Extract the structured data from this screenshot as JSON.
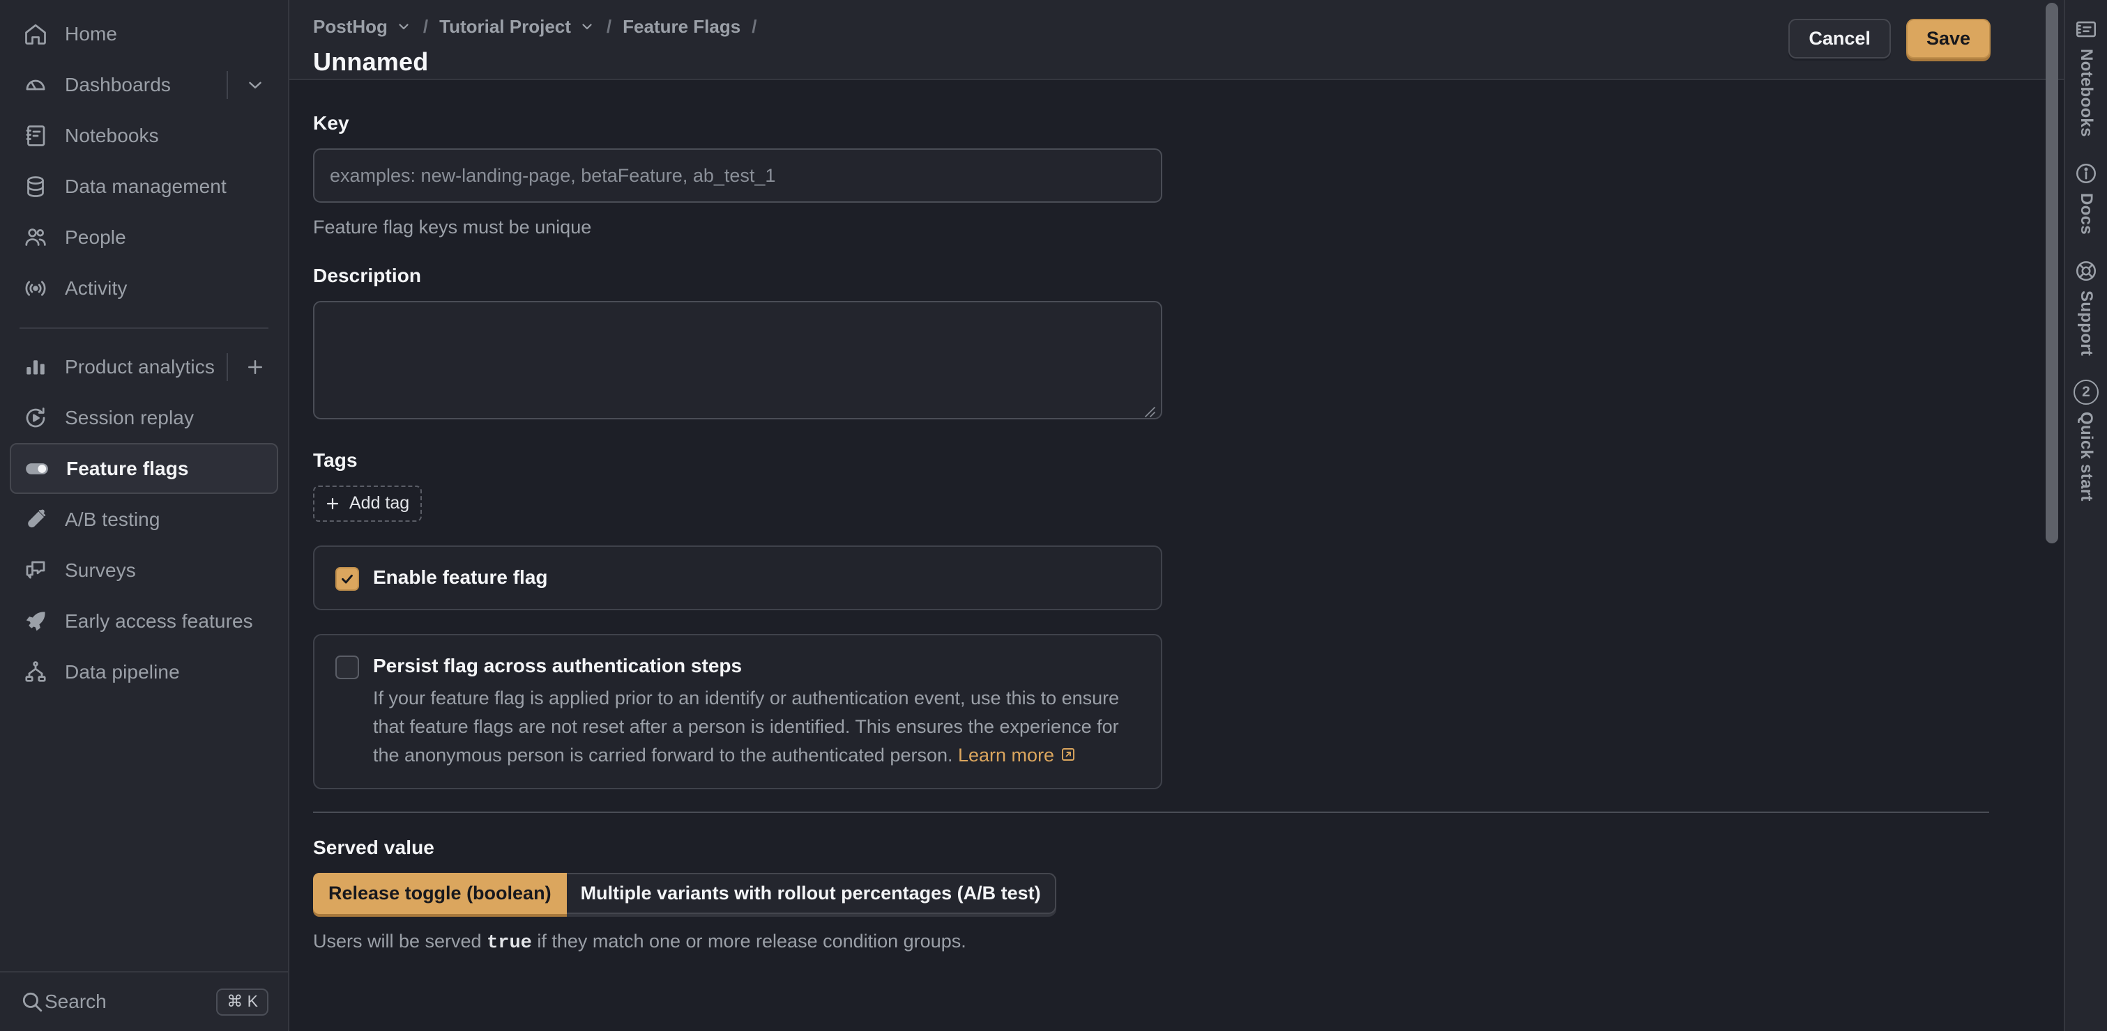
{
  "sidebar": {
    "items": [
      {
        "label": "Home",
        "icon": "home-icon",
        "active": false
      },
      {
        "label": "Dashboards",
        "icon": "dashboards-icon",
        "active": false,
        "trailing": "chevron-down-icon"
      },
      {
        "label": "Notebooks",
        "icon": "notebook-icon",
        "active": false
      },
      {
        "label": "Data management",
        "icon": "database-icon",
        "active": false
      },
      {
        "label": "People",
        "icon": "people-icon",
        "active": false
      },
      {
        "label": "Activity",
        "icon": "activity-icon",
        "active": false
      }
    ],
    "items2": [
      {
        "label": "Product analytics",
        "icon": "bar-chart-icon",
        "active": false,
        "trailing": "plus-icon"
      },
      {
        "label": "Session replay",
        "icon": "play-replay-icon",
        "active": false
      },
      {
        "label": "Feature flags",
        "icon": "toggle-icon",
        "active": true
      },
      {
        "label": "A/B testing",
        "icon": "flask-icon",
        "active": false
      },
      {
        "label": "Surveys",
        "icon": "chat-icon",
        "active": false
      },
      {
        "label": "Early access features",
        "icon": "rocket-icon",
        "active": false
      },
      {
        "label": "Data pipeline",
        "icon": "pipeline-icon",
        "active": false
      }
    ],
    "search": {
      "label": "Search",
      "shortcut": "⌘ K",
      "icon": "search-icon"
    }
  },
  "header": {
    "breadcrumbs": [
      {
        "label": "PostHog",
        "has_chevron": true
      },
      {
        "label": "Tutorial Project",
        "has_chevron": true
      },
      {
        "label": "Feature Flags",
        "has_chevron": false
      }
    ],
    "separator": "/",
    "title": "Unnamed",
    "cancel_label": "Cancel",
    "save_label": "Save"
  },
  "form": {
    "key": {
      "label": "Key",
      "value": "",
      "placeholder": "examples: new-landing-page, betaFeature, ab_test_1",
      "hint": "Feature flag keys must be unique"
    },
    "description": {
      "label": "Description",
      "value": "",
      "placeholder": ""
    },
    "tags": {
      "label": "Tags",
      "add_label": "Add tag"
    },
    "enable_flag": {
      "label": "Enable feature flag",
      "checked": true
    },
    "persist_flag": {
      "label": "Persist flag across authentication steps",
      "checked": false,
      "description": "If your feature flag is applied prior to an identify or authentication event, use this to ensure that feature flags are not reset after a person is identified. This ensures the experience for the anonymous person is carried forward to the authenticated person. ",
      "link_label": "Learn more"
    },
    "served_value": {
      "label": "Served value",
      "options": [
        {
          "label": "Release toggle (boolean)",
          "selected": true
        },
        {
          "label": "Multiple variants with rollout percentages (A/B test)",
          "selected": false
        }
      ],
      "note_prefix": "Users will be served ",
      "note_code": "true",
      "note_suffix": " if they match one or more release condition groups."
    }
  },
  "rail": {
    "items": [
      {
        "label": "Notebooks",
        "icon": "notebook-icon",
        "badge": null
      },
      {
        "label": "Docs",
        "icon": "info-icon",
        "badge": null
      },
      {
        "label": "Support",
        "icon": "lifebuoy-icon",
        "badge": null
      },
      {
        "label": "Quick start",
        "icon": "badge-count-icon",
        "badge": "2"
      }
    ]
  },
  "colors": {
    "accent": "#dba65e",
    "sidebar_bg": "#25272f",
    "main_bg": "#1d1f27",
    "text_primary": "#f4f5f7",
    "text_muted": "#9ba0a8",
    "border": "#45474f"
  }
}
